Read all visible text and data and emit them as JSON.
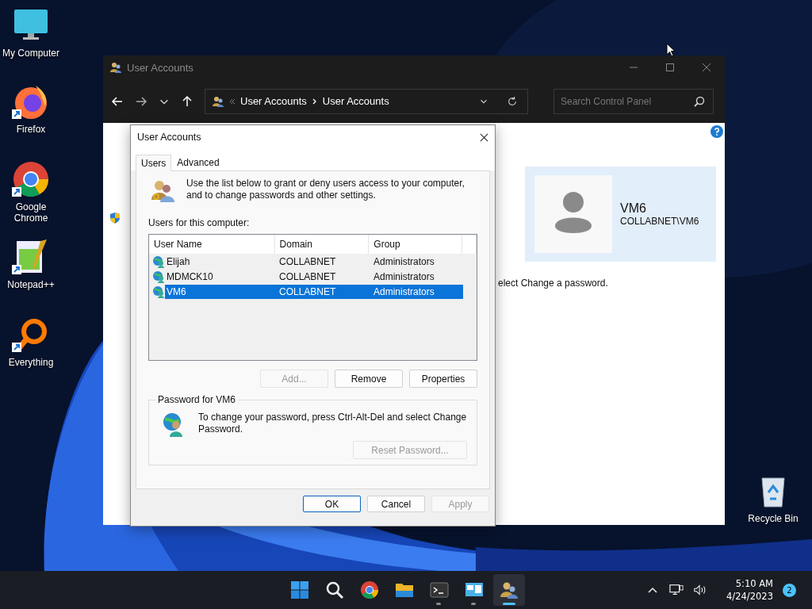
{
  "desktop_icons": [
    {
      "label": "My Computer",
      "kind": "computer",
      "shortcut": false
    },
    {
      "label": "Firefox",
      "kind": "firefox",
      "shortcut": true
    },
    {
      "label": "Google Chrome",
      "kind": "chrome",
      "shortcut": true
    },
    {
      "label": "Notepad++",
      "kind": "notepad",
      "shortcut": true
    },
    {
      "label": "Everything",
      "kind": "everything",
      "shortcut": true
    }
  ],
  "recycle_bin": {
    "label": "Recycle Bin"
  },
  "window": {
    "title": "User Accounts",
    "breadcrumb": [
      "User Accounts",
      "User Accounts"
    ],
    "search": {
      "placeholder": "Search Control Panel"
    },
    "body_tail": "elect Change a password.",
    "account": {
      "name": "VM6",
      "login": "COLLABNET\\VM6"
    }
  },
  "dialog": {
    "title": "User Accounts",
    "tabs": [
      {
        "label": "Users",
        "selected": true
      },
      {
        "label": "Advanced",
        "selected": false
      }
    ],
    "intro": "Use the list below to grant or deny users access to your computer, and to change passwords and other settings.",
    "list_label": "Users for this computer:",
    "table": {
      "columns": [
        "User Name",
        "Domain",
        "Group"
      ],
      "rows": [
        {
          "cells": [
            "Elijah",
            "COLLABNET",
            "Administrators"
          ],
          "selected": false
        },
        {
          "cells": [
            "MDMCK10",
            "COLLABNET",
            "Administrators"
          ],
          "selected": false
        },
        {
          "cells": [
            "VM6",
            "COLLABNET",
            "Administrators"
          ],
          "selected": true
        }
      ]
    },
    "list_buttons": [
      {
        "label": "Add...",
        "disabled": true
      },
      {
        "label": "Remove",
        "disabled": false
      },
      {
        "label": "Properties",
        "disabled": false
      }
    ],
    "password_group": {
      "title": "Password for VM6",
      "text": "To change your password, press Ctrl-Alt-Del and select Change Password.",
      "button": {
        "label": "Reset Password...",
        "disabled": true
      }
    },
    "buttons": [
      {
        "label": "OK",
        "disabled": false,
        "default": true
      },
      {
        "label": "Cancel",
        "disabled": false,
        "default": false
      },
      {
        "label": "Apply",
        "disabled": true,
        "default": false
      }
    ]
  },
  "taskbar": {
    "apps": [
      {
        "kind": "start",
        "running": false,
        "active": false
      },
      {
        "kind": "search",
        "running": false,
        "active": false
      },
      {
        "kind": "chrome",
        "running": false,
        "active": false
      },
      {
        "kind": "folder",
        "running": false,
        "active": false
      },
      {
        "kind": "terminal",
        "running": true,
        "active": false
      },
      {
        "kind": "control",
        "running": true,
        "active": false
      },
      {
        "kind": "users",
        "running": true,
        "active": true
      }
    ],
    "time": "5:10 AM",
    "date": "4/24/2023",
    "notifications": "2"
  }
}
